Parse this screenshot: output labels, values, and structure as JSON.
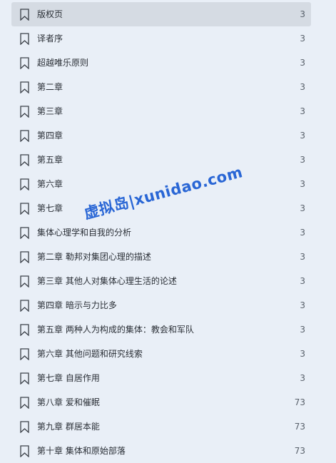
{
  "bookmarks": [
    {
      "title": "版权页",
      "page": "3",
      "selected": true
    },
    {
      "title": "译者序",
      "page": "3"
    },
    {
      "title": "超越唯乐原则",
      "page": "3"
    },
    {
      "title": "第二章",
      "page": "3"
    },
    {
      "title": "第三章",
      "page": "3"
    },
    {
      "title": "第四章",
      "page": "3"
    },
    {
      "title": "第五章",
      "page": "3"
    },
    {
      "title": "第六章",
      "page": "3"
    },
    {
      "title": "第七章",
      "page": "3"
    },
    {
      "title": "集体心理学和自我的分析",
      "page": "3"
    },
    {
      "title": "第二章 勒邦对集团心理的描述",
      "page": "3"
    },
    {
      "title": "第三章 其他人对集体心理生活的论述",
      "page": "3"
    },
    {
      "title": "第四章 暗示与力比多",
      "page": "3"
    },
    {
      "title": "第五章 两种人为构成的集体：教会和军队",
      "page": "3"
    },
    {
      "title": "第六章 其他问题和研究线索",
      "page": "3"
    },
    {
      "title": "第七章 自居作用",
      "page": "3"
    },
    {
      "title": "第八章 爱和催眠",
      "page": "73"
    },
    {
      "title": "第九章 群居本能",
      "page": "73"
    },
    {
      "title": "第十章 集体和原始部落",
      "page": "73"
    }
  ],
  "watermark": "虚拟岛|xunidao.com",
  "icon": "bookmark-icon"
}
